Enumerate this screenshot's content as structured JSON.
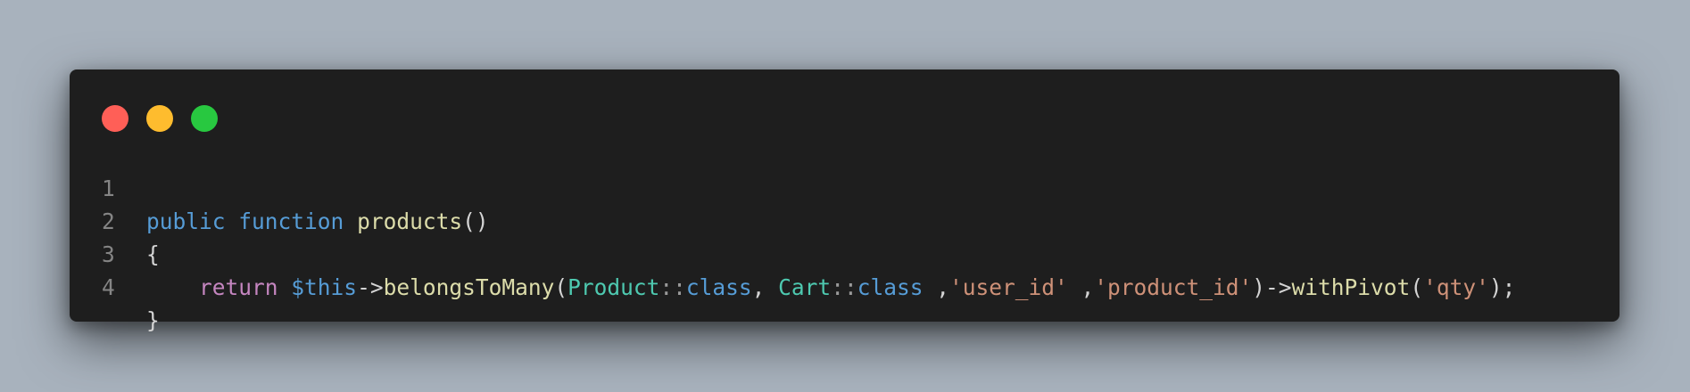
{
  "colors": {
    "page_background": "#a8b2bd",
    "editor_background": "#1e1e1e",
    "close_dot": "#ff5f57",
    "minimize_dot": "#febc2e",
    "maximize_dot": "#28c840",
    "keyword": "#569cd6",
    "control_keyword": "#c586c0",
    "function": "#dcdcaa",
    "class": "#4ec9b0",
    "string": "#ce9178",
    "default_text": "#d4d4d4",
    "line_number": "#858585"
  },
  "window_controls": [
    "close-dot",
    "minimize-dot",
    "maximize-dot"
  ],
  "code": {
    "lines": [
      {
        "number": "1",
        "tokens": [
          "public",
          " ",
          "function",
          " ",
          "products",
          "()"
        ]
      },
      {
        "number": "2",
        "tokens": [
          "{"
        ]
      },
      {
        "number": "3",
        "tokens": [
          "    ",
          "return",
          " ",
          "$this",
          "->",
          "belongsToMany",
          "(",
          "Product",
          "::",
          "class",
          ", ",
          "Cart",
          "::",
          "class",
          " ,",
          "'user_id'",
          " ,",
          "'product_id'",
          ")->",
          "withPivot",
          "(",
          "'qty'",
          ");"
        ]
      },
      {
        "number": "4",
        "tokens": [
          "}"
        ]
      }
    ]
  }
}
